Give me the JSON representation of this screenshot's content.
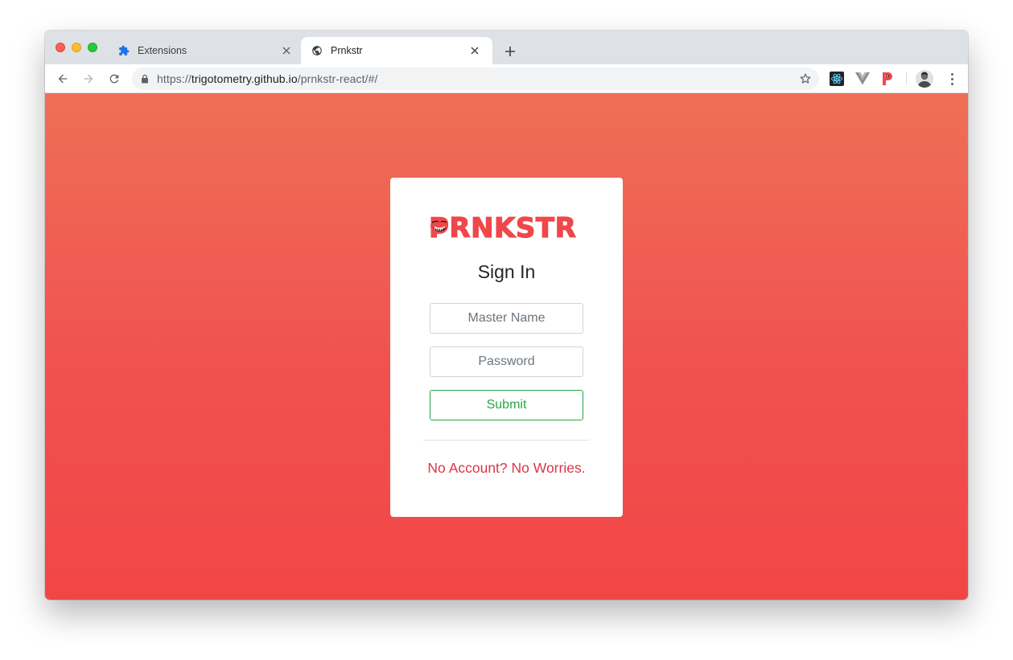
{
  "browser": {
    "tabs": [
      {
        "title": "Extensions",
        "icon": "puzzle-icon",
        "active": false
      },
      {
        "title": "Prnkstr",
        "icon": "globe-icon",
        "active": true
      }
    ],
    "new_tab_label": "+",
    "address": {
      "scheme": "https://",
      "host": "trigotometry.github.io",
      "path": "/prnkstr-react/#/"
    },
    "extensions": [
      "react-devtools-icon",
      "vue-devtools-icon",
      "prnkstr-extension-icon"
    ]
  },
  "login": {
    "logo_text": "PRNKSTR",
    "title": "Sign In",
    "name_placeholder": "Master Name",
    "password_placeholder": "Password",
    "submit_label": "Submit",
    "signup_link": "No Account? No Worries."
  },
  "colors": {
    "brand": "#f0474a",
    "gradient_top": "#ef6f55",
    "gradient_bottom": "#f24646",
    "submit_outline": "#28a745",
    "link": "#dc3545"
  }
}
